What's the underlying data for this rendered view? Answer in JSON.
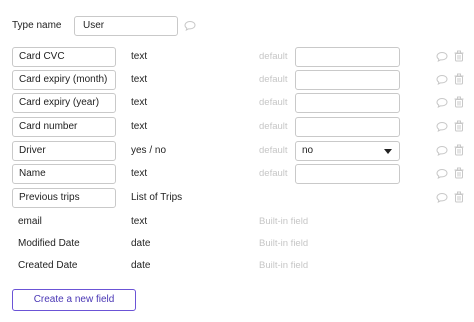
{
  "header": {
    "type_name_label": "Type name",
    "type_name_value": "User",
    "comment_icon": "speech-bubble-icon"
  },
  "fields": [
    {
      "name": "Card CVC",
      "type": "text",
      "default_label": "default",
      "default_value": ""
    },
    {
      "name": "Card expiry (month)",
      "type": "text",
      "default_label": "default",
      "default_value": ""
    },
    {
      "name": "Card expiry (year)",
      "type": "text",
      "default_label": "default",
      "default_value": ""
    },
    {
      "name": "Card number",
      "type": "text",
      "default_label": "default",
      "default_value": ""
    },
    {
      "name": "Driver",
      "type": "yes / no",
      "default_label": "default",
      "default_value": "no"
    },
    {
      "name": "Name",
      "type": "text",
      "default_label": "default",
      "default_value": ""
    },
    {
      "name": "Previous trips",
      "type": "List of Trips"
    }
  ],
  "builtin_fields": [
    {
      "name": "email",
      "type": "text",
      "note": "Built-in field"
    },
    {
      "name": "Modified Date",
      "type": "date",
      "note": "Built-in field"
    },
    {
      "name": "Created Date",
      "type": "date",
      "note": "Built-in field"
    }
  ],
  "actions": {
    "create_label": "Create a new field",
    "accent_color": "#6b53d6",
    "row_icons": [
      "speech-bubble-icon",
      "trash-icon"
    ]
  }
}
